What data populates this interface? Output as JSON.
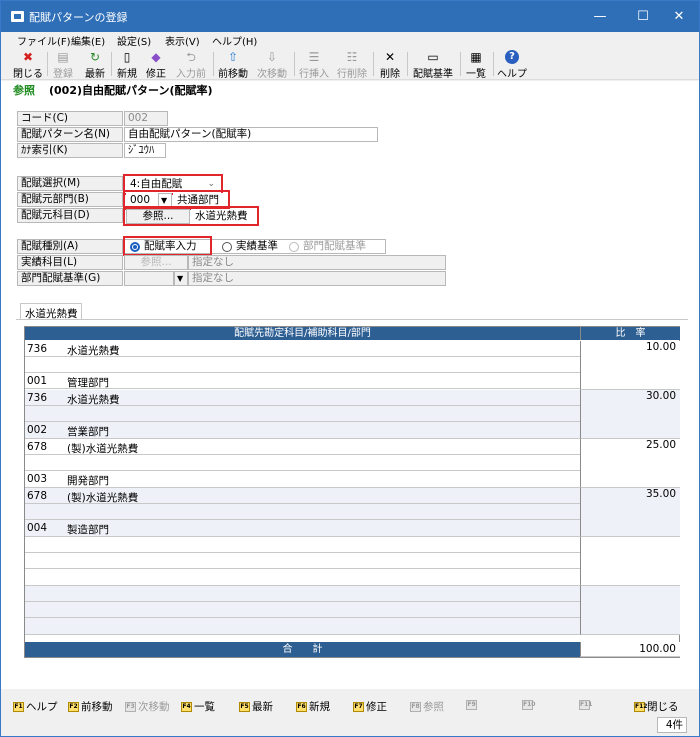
{
  "window": {
    "title": "配賦パターンの登録",
    "min": "—",
    "max": "☐",
    "close": "✕"
  },
  "menu": [
    "ファイル(F)",
    "編集(E)",
    "設定(S)",
    "表示(V)",
    "ヘルプ(H)"
  ],
  "toolbar": [
    {
      "label": "閉じる",
      "icon": "close-red-icon",
      "glyph": "✖",
      "enabled": true
    },
    {
      "label": "登録",
      "icon": "register-icon",
      "glyph": "▤",
      "enabled": false
    },
    {
      "label": "最新",
      "icon": "refresh-icon",
      "glyph": "↻",
      "enabled": true
    },
    {
      "label": "新規",
      "icon": "new-document-icon",
      "glyph": "▯",
      "enabled": true
    },
    {
      "label": "修正",
      "icon": "edit-icon",
      "glyph": "◆",
      "enabled": true
    },
    {
      "label": "入力前",
      "icon": "undo-input-icon",
      "glyph": "⮌",
      "enabled": false
    },
    {
      "label": "前移動",
      "icon": "arrow-up-icon",
      "glyph": "⇧",
      "enabled": true
    },
    {
      "label": "次移動",
      "icon": "arrow-down-icon",
      "glyph": "⇩",
      "enabled": false
    },
    {
      "label": "行挿入",
      "icon": "insert-row-icon",
      "glyph": "☰",
      "enabled": false
    },
    {
      "label": "行削除",
      "icon": "delete-row-icon",
      "glyph": "☷",
      "enabled": false
    },
    {
      "label": "削除",
      "icon": "delete-icon",
      "glyph": "✕",
      "enabled": true
    },
    {
      "label": "配賦基準",
      "icon": "allocation-base-icon",
      "glyph": "▭",
      "enabled": true
    },
    {
      "label": "一覧",
      "icon": "list-icon",
      "glyph": "▦",
      "enabled": true
    },
    {
      "label": "ヘルプ",
      "icon": "help-icon",
      "glyph": "?",
      "enabled": true
    }
  ],
  "header": {
    "ref": "参照",
    "title": "(002)自由配賦パターン(配賦率)"
  },
  "form": {
    "code_label": "コード(C)",
    "code_value": "002",
    "name_label": "配賦パターン名(N)",
    "name_value": "自由配賦パターン(配賦率)",
    "kana_label": "ｶﾅ索引(K)",
    "kana_value": "ｼﾞﾕｳﾊ",
    "select_label": "配賦選択(M)",
    "select_value": "4:自由配賦",
    "src_dept_label": "配賦元部門(B)",
    "src_dept_code": "000",
    "src_dept_name": "共通部門",
    "src_acct_label": "配賦元科目(D)",
    "src_acct_button": "参照...",
    "src_acct_name": "水道光熱費",
    "kind_label": "配賦種別(A)",
    "kind_options": [
      "配賦率入力",
      "実績基準",
      "部門配賦基準"
    ],
    "actual_acct_label": "実績科目(L)",
    "actual_acct_button": "参照...",
    "actual_acct_value": "指定なし",
    "dept_base_label": "部門配賦基準(G)",
    "dept_base_value": "指定なし"
  },
  "tab": "水道光熱費",
  "grid": {
    "col_main": "配賦先勘定科目/補助科目/部門",
    "col_ratio": "比　率",
    "rows": [
      {
        "acct_code": "736",
        "acct_name": "水道光熱費",
        "dept_code": "001",
        "dept_name": "管理部門",
        "ratio": "10.00"
      },
      {
        "acct_code": "736",
        "acct_name": "水道光熱費",
        "dept_code": "002",
        "dept_name": "営業部門",
        "ratio": "30.00"
      },
      {
        "acct_code": "678",
        "acct_name": "(製)水道光熱費",
        "dept_code": "003",
        "dept_name": "開発部門",
        "ratio": "25.00"
      },
      {
        "acct_code": "678",
        "acct_name": "(製)水道光熱費",
        "dept_code": "004",
        "dept_name": "製造部門",
        "ratio": "35.00"
      }
    ],
    "total_label": "合　　計",
    "total_value": "100.00"
  },
  "fkeys": [
    {
      "key": "F1",
      "label": "ヘルプ",
      "enabled": true
    },
    {
      "key": "F2",
      "label": "前移動",
      "enabled": true
    },
    {
      "key": "F3",
      "label": "次移動",
      "enabled": false
    },
    {
      "key": "F4",
      "label": "一覧",
      "enabled": true
    },
    {
      "key": "F5",
      "label": "最新",
      "enabled": true
    },
    {
      "key": "F6",
      "label": "新規",
      "enabled": true
    },
    {
      "key": "F7",
      "label": "修正",
      "enabled": true
    },
    {
      "key": "F8",
      "label": "参照",
      "enabled": false
    },
    {
      "key": "F9",
      "label": "",
      "enabled": false
    },
    {
      "key": "F10",
      "label": "",
      "enabled": false
    },
    {
      "key": "F11",
      "label": "",
      "enabled": false
    },
    {
      "key": "F12",
      "label": "閉じる",
      "enabled": true
    }
  ],
  "status": {
    "count": "4件"
  }
}
